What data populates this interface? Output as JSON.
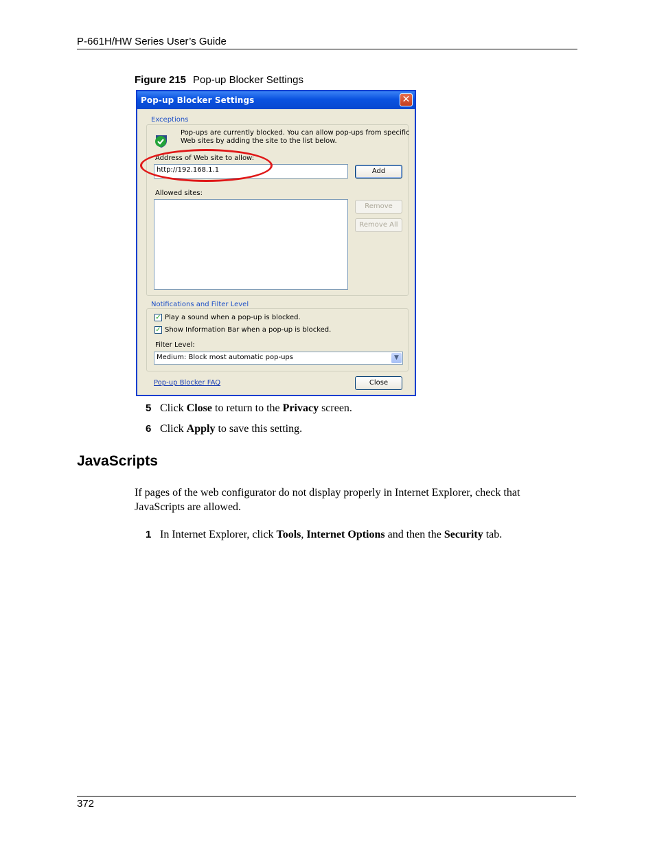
{
  "header": {
    "title": "P-661H/HW Series User’s Guide"
  },
  "figure": {
    "label": "Figure 215",
    "title": "Pop-up Blocker Settings"
  },
  "dialog": {
    "title": "Pop-up Blocker Settings",
    "close_glyph": "✕",
    "exceptions": {
      "legend": "Exceptions",
      "info_line1": "Pop-ups are currently blocked.  You can allow pop-ups from specific",
      "info_line2": "Web sites by adding the site to the list below.",
      "address_label": "Address of Web site to allow:",
      "address_value": "http://192.168.1.1",
      "add_button": "Add",
      "allowed_label": "Allowed sites:",
      "remove_button": "Remove",
      "remove_all_button": "Remove All"
    },
    "notifications": {
      "legend": "Notifications and Filter Level",
      "play_sound_label": "Play a sound when a pop-up is blocked.",
      "show_bar_label": "Show Information Bar when a pop-up is blocked.",
      "filter_label": "Filter Level:",
      "filter_value": "Medium: Block most automatic pop-ups"
    },
    "faq_link": "Pop-up Blocker FAQ",
    "close_button": "Close",
    "check_glyph": "✓",
    "arrow_glyph": "▼"
  },
  "steps_a": [
    {
      "num": "5",
      "pre": "Click ",
      "bold": "Close",
      "post": " to return to the ",
      "bold2": "Privacy",
      "post2": " screen."
    },
    {
      "num": "6",
      "pre": "Click ",
      "bold": "Apply",
      "post": " to save this setting."
    }
  ],
  "section": {
    "heading": "JavaScripts",
    "paragraph": "If pages of the web configurator do not display properly in Internet Explorer, check that JavaScripts are allowed."
  },
  "step_b": {
    "num": "1",
    "pre": "In Internet Explorer, click ",
    "b1": "Tools",
    "s1": ", ",
    "b2": "Internet Options",
    "s2": " and then the ",
    "b3": "Security",
    "s3": " tab."
  },
  "footer": {
    "page_number": "372"
  }
}
